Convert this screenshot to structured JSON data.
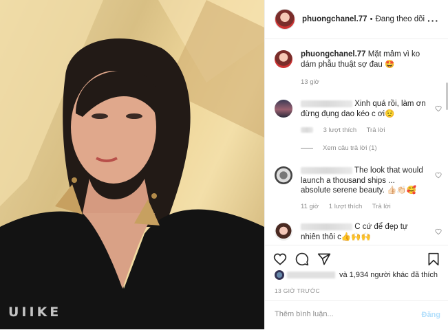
{
  "photo": {
    "watermark": "UIIKE"
  },
  "header": {
    "username": "phuongchanel.77",
    "separator": "•",
    "follow_status": "Đang theo dõi",
    "more": "···"
  },
  "caption": {
    "username": "phuongchanel.77",
    "text": "Mặt mâm vì ko dám phẫu thuật sợ đau 🤩",
    "time": "13 giờ"
  },
  "comments": [
    {
      "text": "Xinh quá rồi, làm ơn đừng đụng dao kéo c ơi😟",
      "likes": "3 lượt thích",
      "reply": "Trả lời",
      "view_replies": "Xem câu trả lời (1)"
    },
    {
      "text": "The look that would launch a thousand ships ... absolute serene beauty. 👍🏻👏🏻🥰",
      "time": "11 giờ",
      "likes": "1 lượt thích",
      "reply": "Trả lời"
    },
    {
      "text": "C cứ để đẹp tự nhiên thôi c👍🙌🙌"
    }
  ],
  "likes": {
    "text": "và 1,934 người khác đã thích"
  },
  "timestamp": "13 GIỜ TRƯỚC",
  "add_comment": {
    "placeholder": "Thêm bình luận...",
    "post_label": "Đăng"
  },
  "colors": {
    "accent_blue": "#b2dffc",
    "meta_gray": "#8e8e8e"
  }
}
